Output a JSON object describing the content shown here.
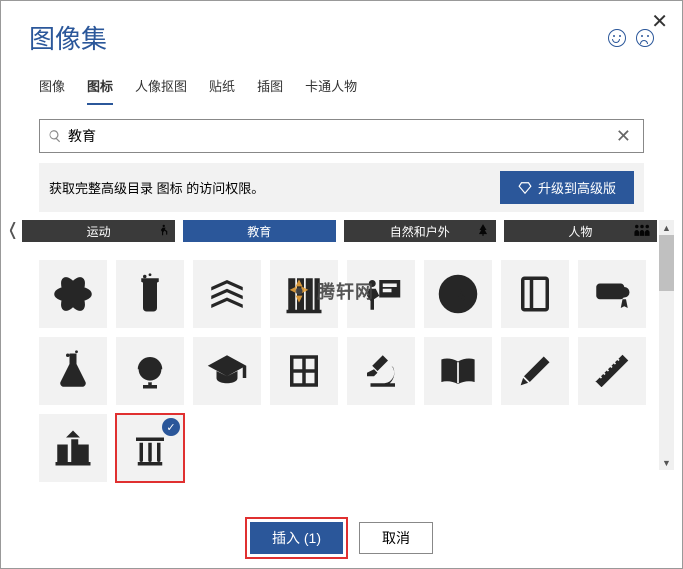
{
  "title": "图像集",
  "tabs": [
    "图像",
    "图标",
    "人像抠图",
    "贴纸",
    "插图",
    "卡通人物"
  ],
  "active_tab": 1,
  "search": {
    "value": "教育"
  },
  "promo": {
    "text": "获取完整高级目录 图标 的访问权限。",
    "upgrade": "升级到高级版"
  },
  "categories": [
    {
      "label": "运动",
      "active": false,
      "deco": "runner"
    },
    {
      "label": "教育",
      "active": true,
      "deco": null
    },
    {
      "label": "自然和户外",
      "active": false,
      "deco": "tree"
    },
    {
      "label": "人物",
      "active": false,
      "deco": "people"
    }
  ],
  "icons": [
    {
      "name": "atom"
    },
    {
      "name": "beaker"
    },
    {
      "name": "books"
    },
    {
      "name": "bookshelf"
    },
    {
      "name": "presentation"
    },
    {
      "name": "clock"
    },
    {
      "name": "notebook"
    },
    {
      "name": "diploma"
    },
    {
      "name": "flask"
    },
    {
      "name": "globe"
    },
    {
      "name": "grad-cap"
    },
    {
      "name": "calculator"
    },
    {
      "name": "microscope"
    },
    {
      "name": "open-book"
    },
    {
      "name": "pencil"
    },
    {
      "name": "ruler"
    },
    {
      "name": "school"
    },
    {
      "name": "test-tubes",
      "selected": true
    }
  ],
  "watermark": "腾轩网",
  "buttons": {
    "insert": "插入 (1)",
    "cancel": "取消"
  }
}
